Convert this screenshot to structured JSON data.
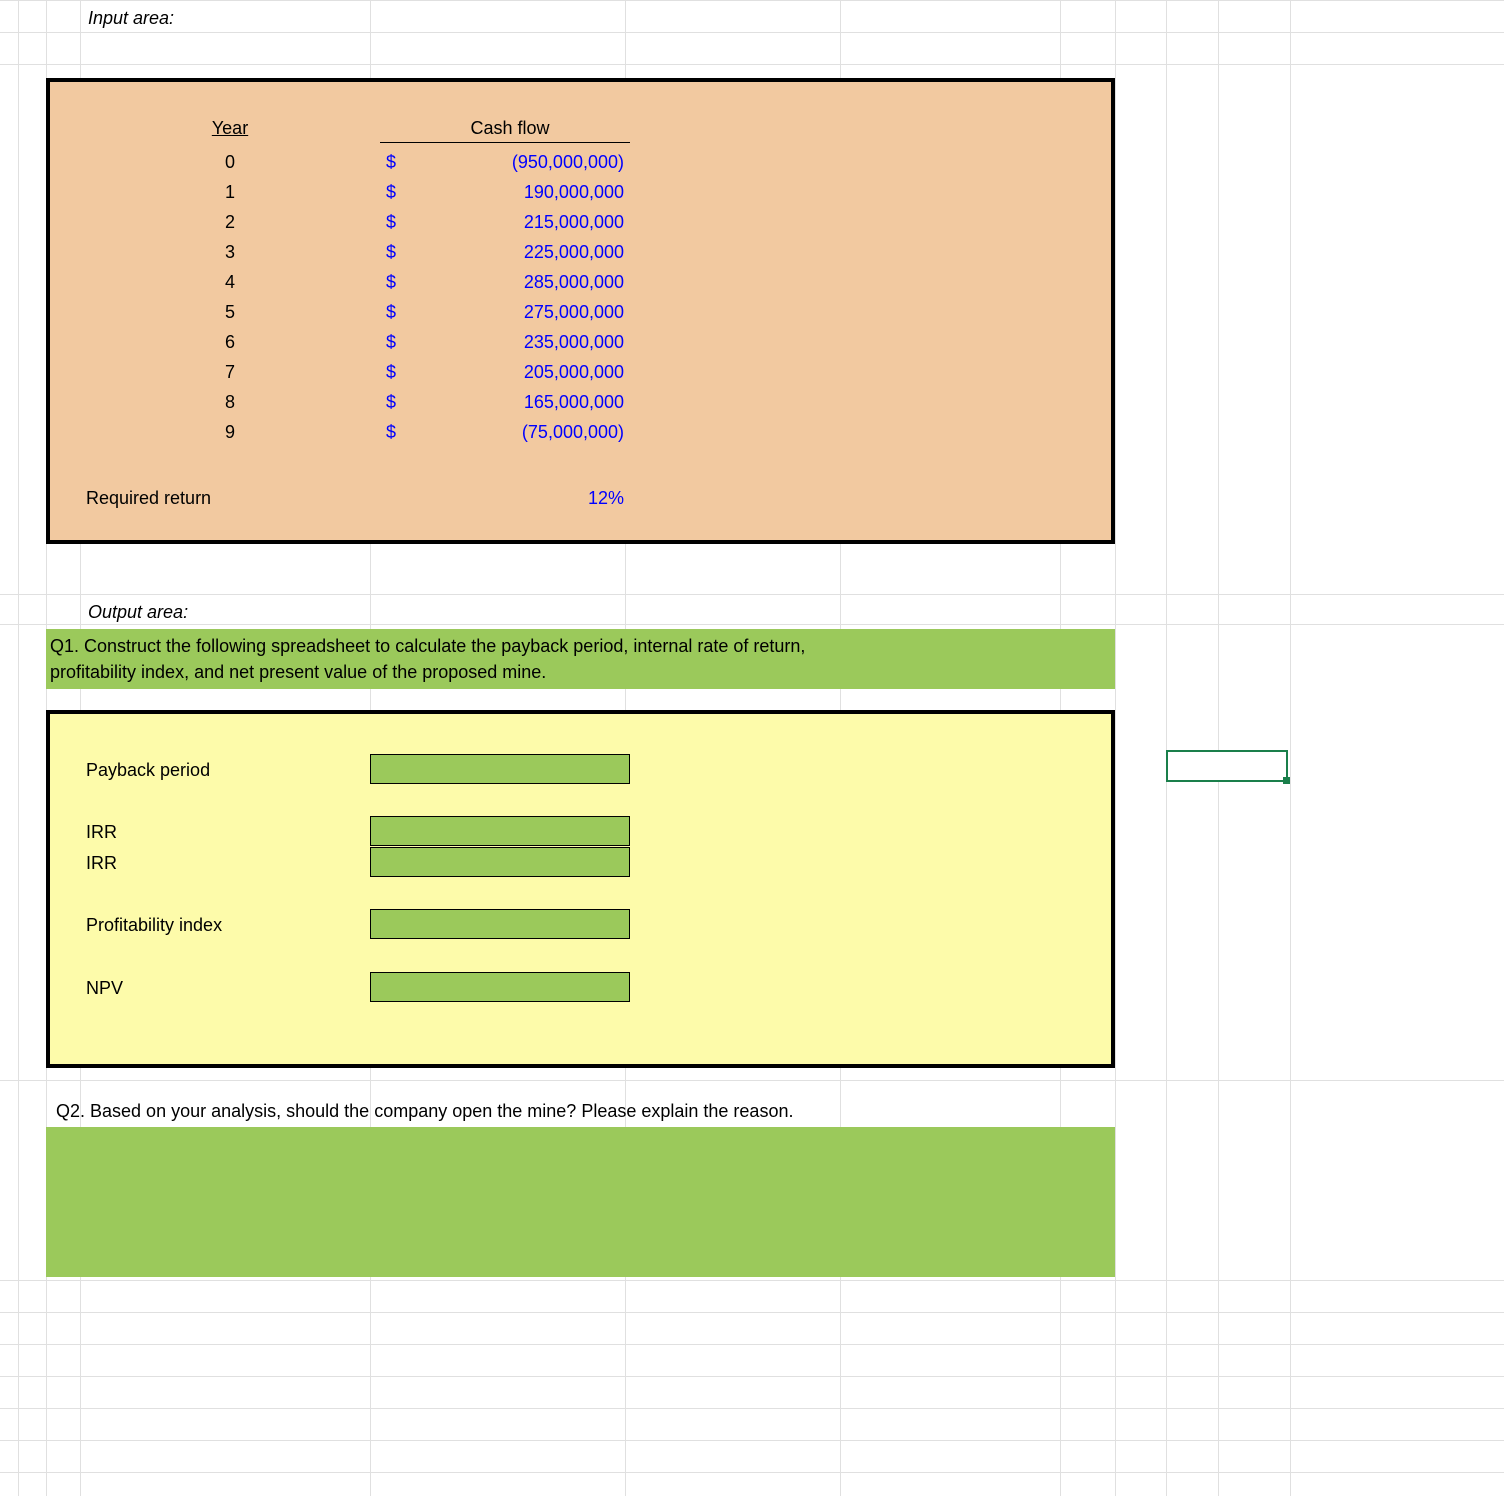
{
  "labels": {
    "input_area": "Input area:",
    "year": "Year",
    "cash_flow": "Cash flow",
    "required_return": "Required return",
    "output_area": "Output area:",
    "payback_period": "Payback period",
    "irr1": "IRR",
    "irr2": "IRR",
    "profitability_index": "Profitability index",
    "npv": "NPV"
  },
  "required_return_value": "12%",
  "q1_line1": "Q1. Construct the following spreadsheet to calculate the payback period, internal rate of return,",
  "q1_line2": "profitability index, and net present value of the proposed mine.",
  "q2": "Q2. Based on your analysis, should the company open the mine? Please explain the reason.",
  "cashflows": [
    {
      "year": "0",
      "sym": "$",
      "value": "(950,000,000)"
    },
    {
      "year": "1",
      "sym": "$",
      "value": "190,000,000"
    },
    {
      "year": "2",
      "sym": "$",
      "value": "215,000,000"
    },
    {
      "year": "3",
      "sym": "$",
      "value": "225,000,000"
    },
    {
      "year": "4",
      "sym": "$",
      "value": "285,000,000"
    },
    {
      "year": "5",
      "sym": "$",
      "value": "275,000,000"
    },
    {
      "year": "6",
      "sym": "$",
      "value": "235,000,000"
    },
    {
      "year": "7",
      "sym": "$",
      "value": "205,000,000"
    },
    {
      "year": "8",
      "sym": "$",
      "value": "165,000,000"
    },
    {
      "year": "9",
      "sym": "$",
      "value": "(75,000,000)"
    }
  ],
  "chart_data": {
    "type": "table",
    "title": "Cash flow by year",
    "columns": [
      "Year",
      "Cash flow ($)"
    ],
    "rows": [
      [
        0,
        -950000000
      ],
      [
        1,
        190000000
      ],
      [
        2,
        215000000
      ],
      [
        3,
        225000000
      ],
      [
        4,
        285000000
      ],
      [
        5,
        275000000
      ],
      [
        6,
        235000000
      ],
      [
        7,
        205000000
      ],
      [
        8,
        165000000
      ],
      [
        9,
        -75000000
      ]
    ],
    "required_return": 0.12
  }
}
